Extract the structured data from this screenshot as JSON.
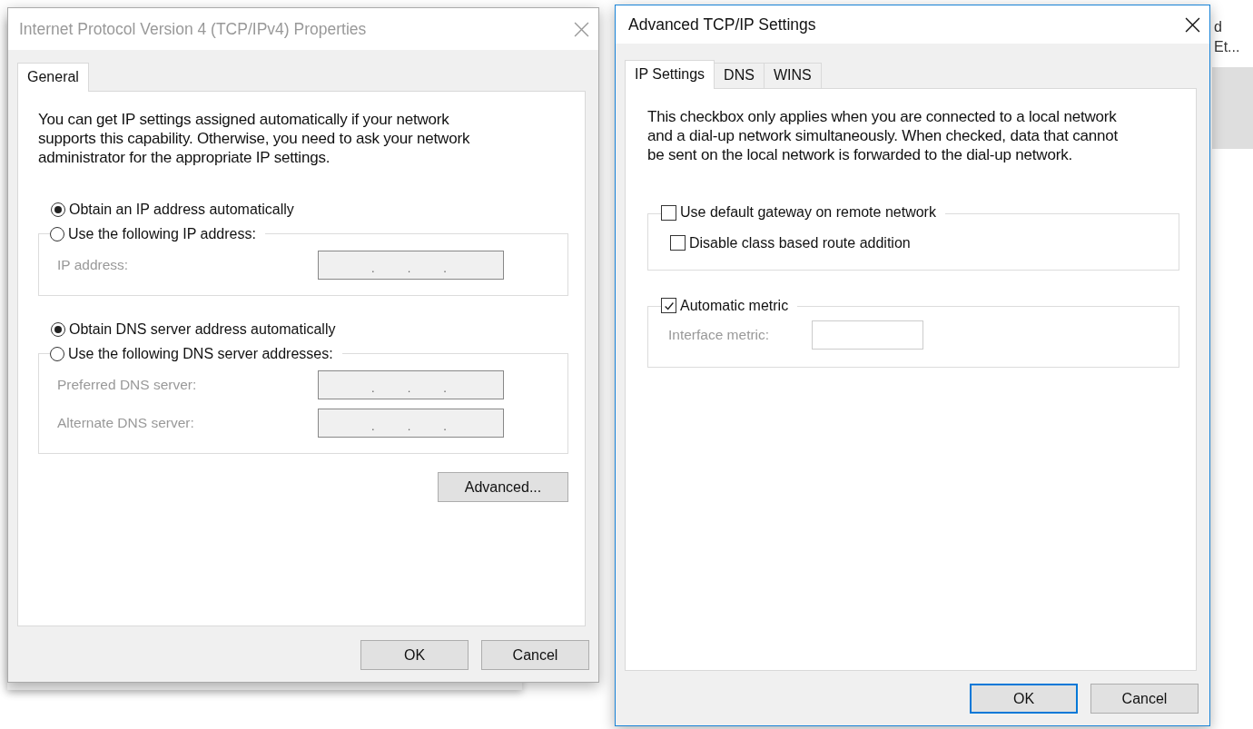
{
  "background_window": {
    "texts": [
      "d",
      "Et..."
    ]
  },
  "dialogs": [
    {
      "title": "Internet Protocol Version 4 (TCP/IPv4) Properties",
      "active": false,
      "tabs": [
        {
          "label": "General",
          "selected": true
        }
      ],
      "description": "You can get IP settings assigned automatically if your network supports this capability. Otherwise, you need to ask your network administrator for the appropriate IP settings.",
      "controls": [
        {
          "kind": "radio",
          "label": "Obtain an IP address automatically",
          "selected": true
        },
        {
          "kind": "group",
          "header": {
            "kind": "radio",
            "label": "Use the following IP address:",
            "selected": false
          },
          "rows": [
            {
              "kind": "ip_field",
              "label": "IP address:",
              "disabled": true,
              "dots": [
                ".",
                ".",
                "."
              ]
            }
          ]
        },
        {
          "kind": "radio",
          "label": "Obtain DNS server address automatically",
          "selected": true
        },
        {
          "kind": "group",
          "header": {
            "kind": "radio",
            "label": "Use the following DNS server addresses:",
            "selected": false
          },
          "rows": [
            {
              "kind": "ip_field",
              "label": "Preferred DNS server:",
              "disabled": true,
              "dots": [
                ".",
                ".",
                "."
              ]
            },
            {
              "kind": "ip_field",
              "label": "Alternate DNS server:",
              "disabled": true,
              "dots": [
                ".",
                ".",
                "."
              ]
            }
          ]
        },
        {
          "kind": "button",
          "label": "Advanced..."
        }
      ],
      "buttons": [
        {
          "label": "OK",
          "default": false
        },
        {
          "label": "Cancel",
          "default": false
        }
      ]
    },
    {
      "title": "Advanced TCP/IP Settings",
      "active": true,
      "tabs": [
        {
          "label": "IP Settings",
          "selected": true
        },
        {
          "label": "DNS",
          "selected": false
        },
        {
          "label": "WINS",
          "selected": false
        }
      ],
      "description": "This checkbox only applies when you are connected to a local network and a dial-up network simultaneously.  When checked, data that cannot be sent on the local network is forwarded to the dial-up network.",
      "controls": [
        {
          "kind": "group",
          "header": {
            "kind": "checkbox",
            "label": "Use default gateway on remote network",
            "checked": false
          },
          "rows": [
            {
              "kind": "checkbox",
              "label": "Disable class based route addition",
              "checked": false
            }
          ]
        },
        {
          "kind": "group",
          "header": {
            "kind": "checkbox",
            "label": "Automatic metric",
            "checked": true
          },
          "rows": [
            {
              "kind": "field",
              "label": "Interface metric:",
              "disabled": true
            }
          ]
        }
      ],
      "buttons": [
        {
          "label": "OK",
          "default": true
        },
        {
          "label": "Cancel",
          "default": false
        }
      ]
    }
  ]
}
